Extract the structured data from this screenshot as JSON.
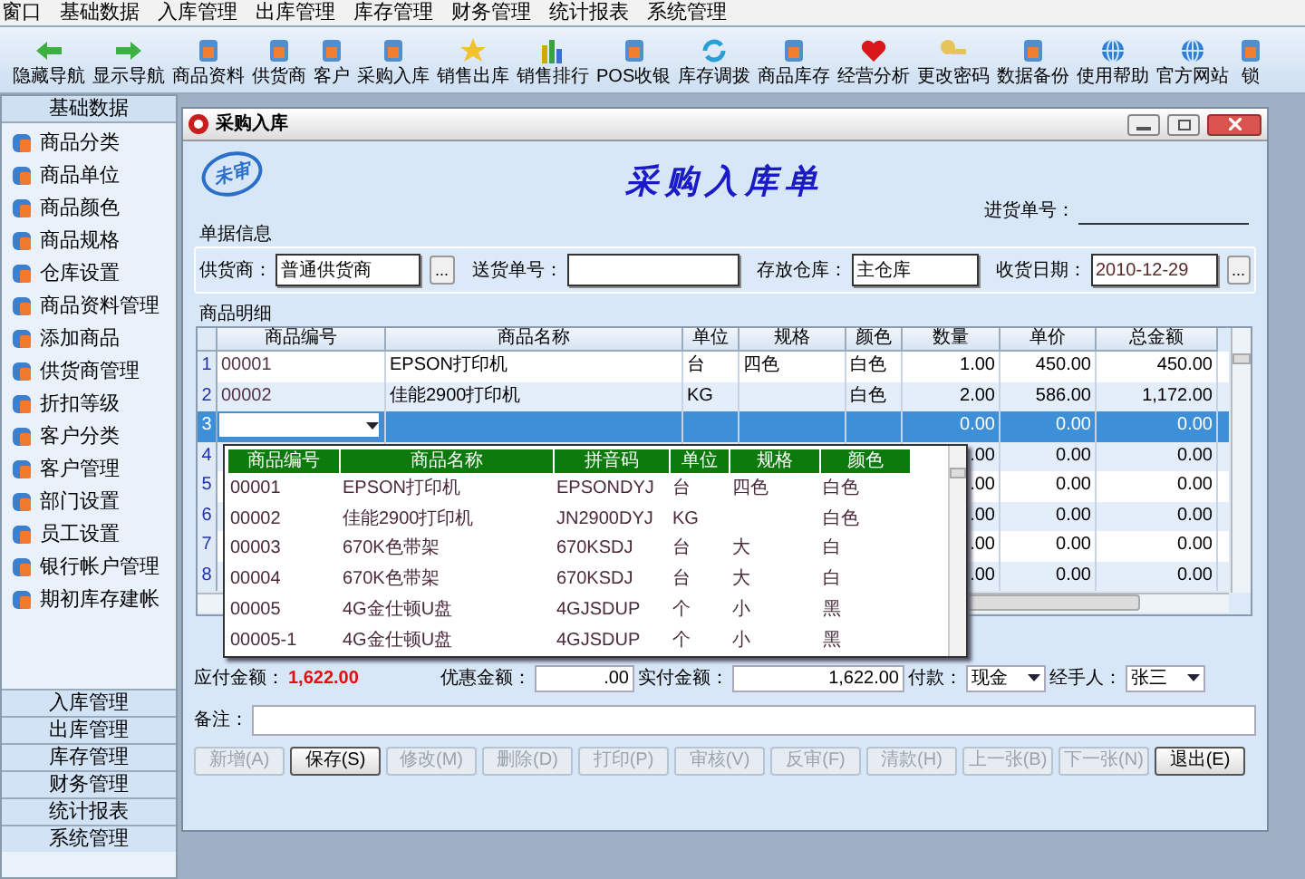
{
  "menu": [
    "窗口",
    "基础数据",
    "入库管理",
    "出库管理",
    "库存管理",
    "财务管理",
    "统计报表",
    "系统管理"
  ],
  "toolbar": [
    {
      "label": "隐藏导航",
      "kind": "left"
    },
    {
      "label": "显示导航",
      "kind": "right"
    },
    {
      "label": "商品资料",
      "kind": "tile"
    },
    {
      "label": "供货商",
      "kind": "tile"
    },
    {
      "label": "客户",
      "kind": "tile"
    },
    {
      "label": "采购入库",
      "kind": "tile"
    },
    {
      "label": "销售出库",
      "kind": "star"
    },
    {
      "label": "销售排行",
      "kind": "bars"
    },
    {
      "label": "POS收银",
      "kind": "tile"
    },
    {
      "label": "库存调拨",
      "kind": "cycle"
    },
    {
      "label": "商品库存",
      "kind": "tile"
    },
    {
      "label": "经营分析",
      "kind": "heart"
    },
    {
      "label": "更改密码",
      "kind": "key"
    },
    {
      "label": "数据备份",
      "kind": "tile"
    },
    {
      "label": "使用帮助",
      "kind": "globe"
    },
    {
      "label": "官方网站",
      "kind": "globe"
    },
    {
      "label": "锁",
      "kind": "tile"
    }
  ],
  "sidebar": {
    "header": "基础数据",
    "items": [
      "商品分类",
      "商品单位",
      "商品颜色",
      "商品规格",
      "仓库设置",
      "商品资料管理",
      "添加商品",
      "供货商管理",
      "折扣等级",
      "客户分类",
      "客户管理",
      "部门设置",
      "员工设置",
      "银行帐户管理",
      "期初库存建帐"
    ],
    "sections": [
      "入库管理",
      "出库管理",
      "库存管理",
      "财务管理",
      "统计报表",
      "系统管理"
    ]
  },
  "window": {
    "title": "采购入库",
    "stamp": "未审",
    "heading": "采购入库单",
    "order_no_label": "进货单号："
  },
  "doc_info": {
    "title": "单据信息",
    "fields": [
      {
        "label": "供货商：",
        "value": "普通供货商",
        "browse": "..."
      },
      {
        "label": "送货单号："
      },
      {
        "label": "存放仓库：",
        "value": "主仓库"
      },
      {
        "label": "收货日期：",
        "value": "2010-12-29",
        "browse": "..."
      }
    ]
  },
  "grid": {
    "title": "商品明细",
    "columns": [
      "商品编号",
      "商品名称",
      "单位",
      "规格",
      "颜色",
      "数量",
      "单价",
      "总金额"
    ],
    "rows": [
      {
        "no": "1",
        "code": "00001",
        "name": "EPSON打印机",
        "unit": "台",
        "spec": "四色",
        "color_name": "白色",
        "qty": "1.00",
        "price": "450.00",
        "total": "450.00",
        "selected": false
      },
      {
        "no": "2",
        "code": "00002",
        "name": "佳能2900打印机",
        "unit": "KG",
        "color_name": "白色",
        "qty": "2.00",
        "price": "586.00",
        "total": "1,172.00",
        "selected": false
      },
      {
        "no": "3",
        "qty": "0.00",
        "price": "0.00",
        "total": "0.00",
        "selected": true
      },
      {
        "no": "4",
        "qty": ".00",
        "price": "0.00",
        "total": "0.00",
        "selected": false
      },
      {
        "no": "5",
        "qty": ".00",
        "price": "0.00",
        "total": "0.00",
        "selected": false
      },
      {
        "no": "6",
        "qty": ".00",
        "price": "0.00",
        "total": "0.00",
        "selected": false
      },
      {
        "no": "7",
        "qty": ".00",
        "price": "0.00",
        "total": "0.00",
        "selected": false
      },
      {
        "no": "8",
        "qty": ".00",
        "price": "0.00",
        "total": "0.00",
        "selected": false
      }
    ]
  },
  "dropdown": {
    "columns": [
      "商品编号",
      "商品名称",
      "拼音码",
      "单位",
      "规格",
      "颜色"
    ],
    "rows": [
      {
        "code": "00001",
        "name": "EPSON打印机",
        "pinyin": "EPSONDYJ",
        "unit": "台",
        "spec": "四色",
        "color_name": "白色"
      },
      {
        "code": "00002",
        "name": "佳能2900打印机",
        "pinyin": "JN2900DYJ",
        "unit": "KG",
        "color_name": "白色"
      },
      {
        "code": "00003",
        "name": "670K色带架",
        "pinyin": "670KSDJ",
        "unit": "台",
        "spec": "大",
        "color_name": "白"
      },
      {
        "code": "00004",
        "name": "670K色带架",
        "pinyin": "670KSDJ",
        "unit": "台",
        "spec": "大",
        "color_name": "白"
      },
      {
        "code": "00005",
        "name": "4G金仕顿U盘",
        "pinyin": "4GJSDUP",
        "unit": "个",
        "spec": "小",
        "color_name": "黑"
      },
      {
        "code": "00005-1",
        "name": "4G金仕顿U盘",
        "pinyin": "4GJSDUP",
        "unit": "个",
        "spec": "小",
        "color_name": "黑"
      }
    ]
  },
  "summary": {
    "payable_label": "应付金额：",
    "payable": "1,622.00",
    "discount_label": "优惠金额：",
    "discount": ".00",
    "paid_label": "实付金额：",
    "paid": "1,622.00",
    "payment_label": "付款：",
    "payment": "现金",
    "handler_label": "经手人：",
    "handler": "张三",
    "remark_label": "备注："
  },
  "buttons": [
    {
      "label": "新增(A)",
      "disabled": true
    },
    {
      "label": "保存(S)",
      "disabled": false
    },
    {
      "label": "修改(M)",
      "disabled": true
    },
    {
      "label": "删除(D)",
      "disabled": true
    },
    {
      "label": "打印(P)",
      "disabled": true
    },
    {
      "label": "审核(V)",
      "disabled": true
    },
    {
      "label": "反审(F)",
      "disabled": true
    },
    {
      "label": "清款(H)",
      "disabled": true
    },
    {
      "label": "上一张(B)",
      "disabled": true
    },
    {
      "label": "下一张(N)",
      "disabled": true
    },
    {
      "label": "退出(E)",
      "disabled": false
    }
  ]
}
